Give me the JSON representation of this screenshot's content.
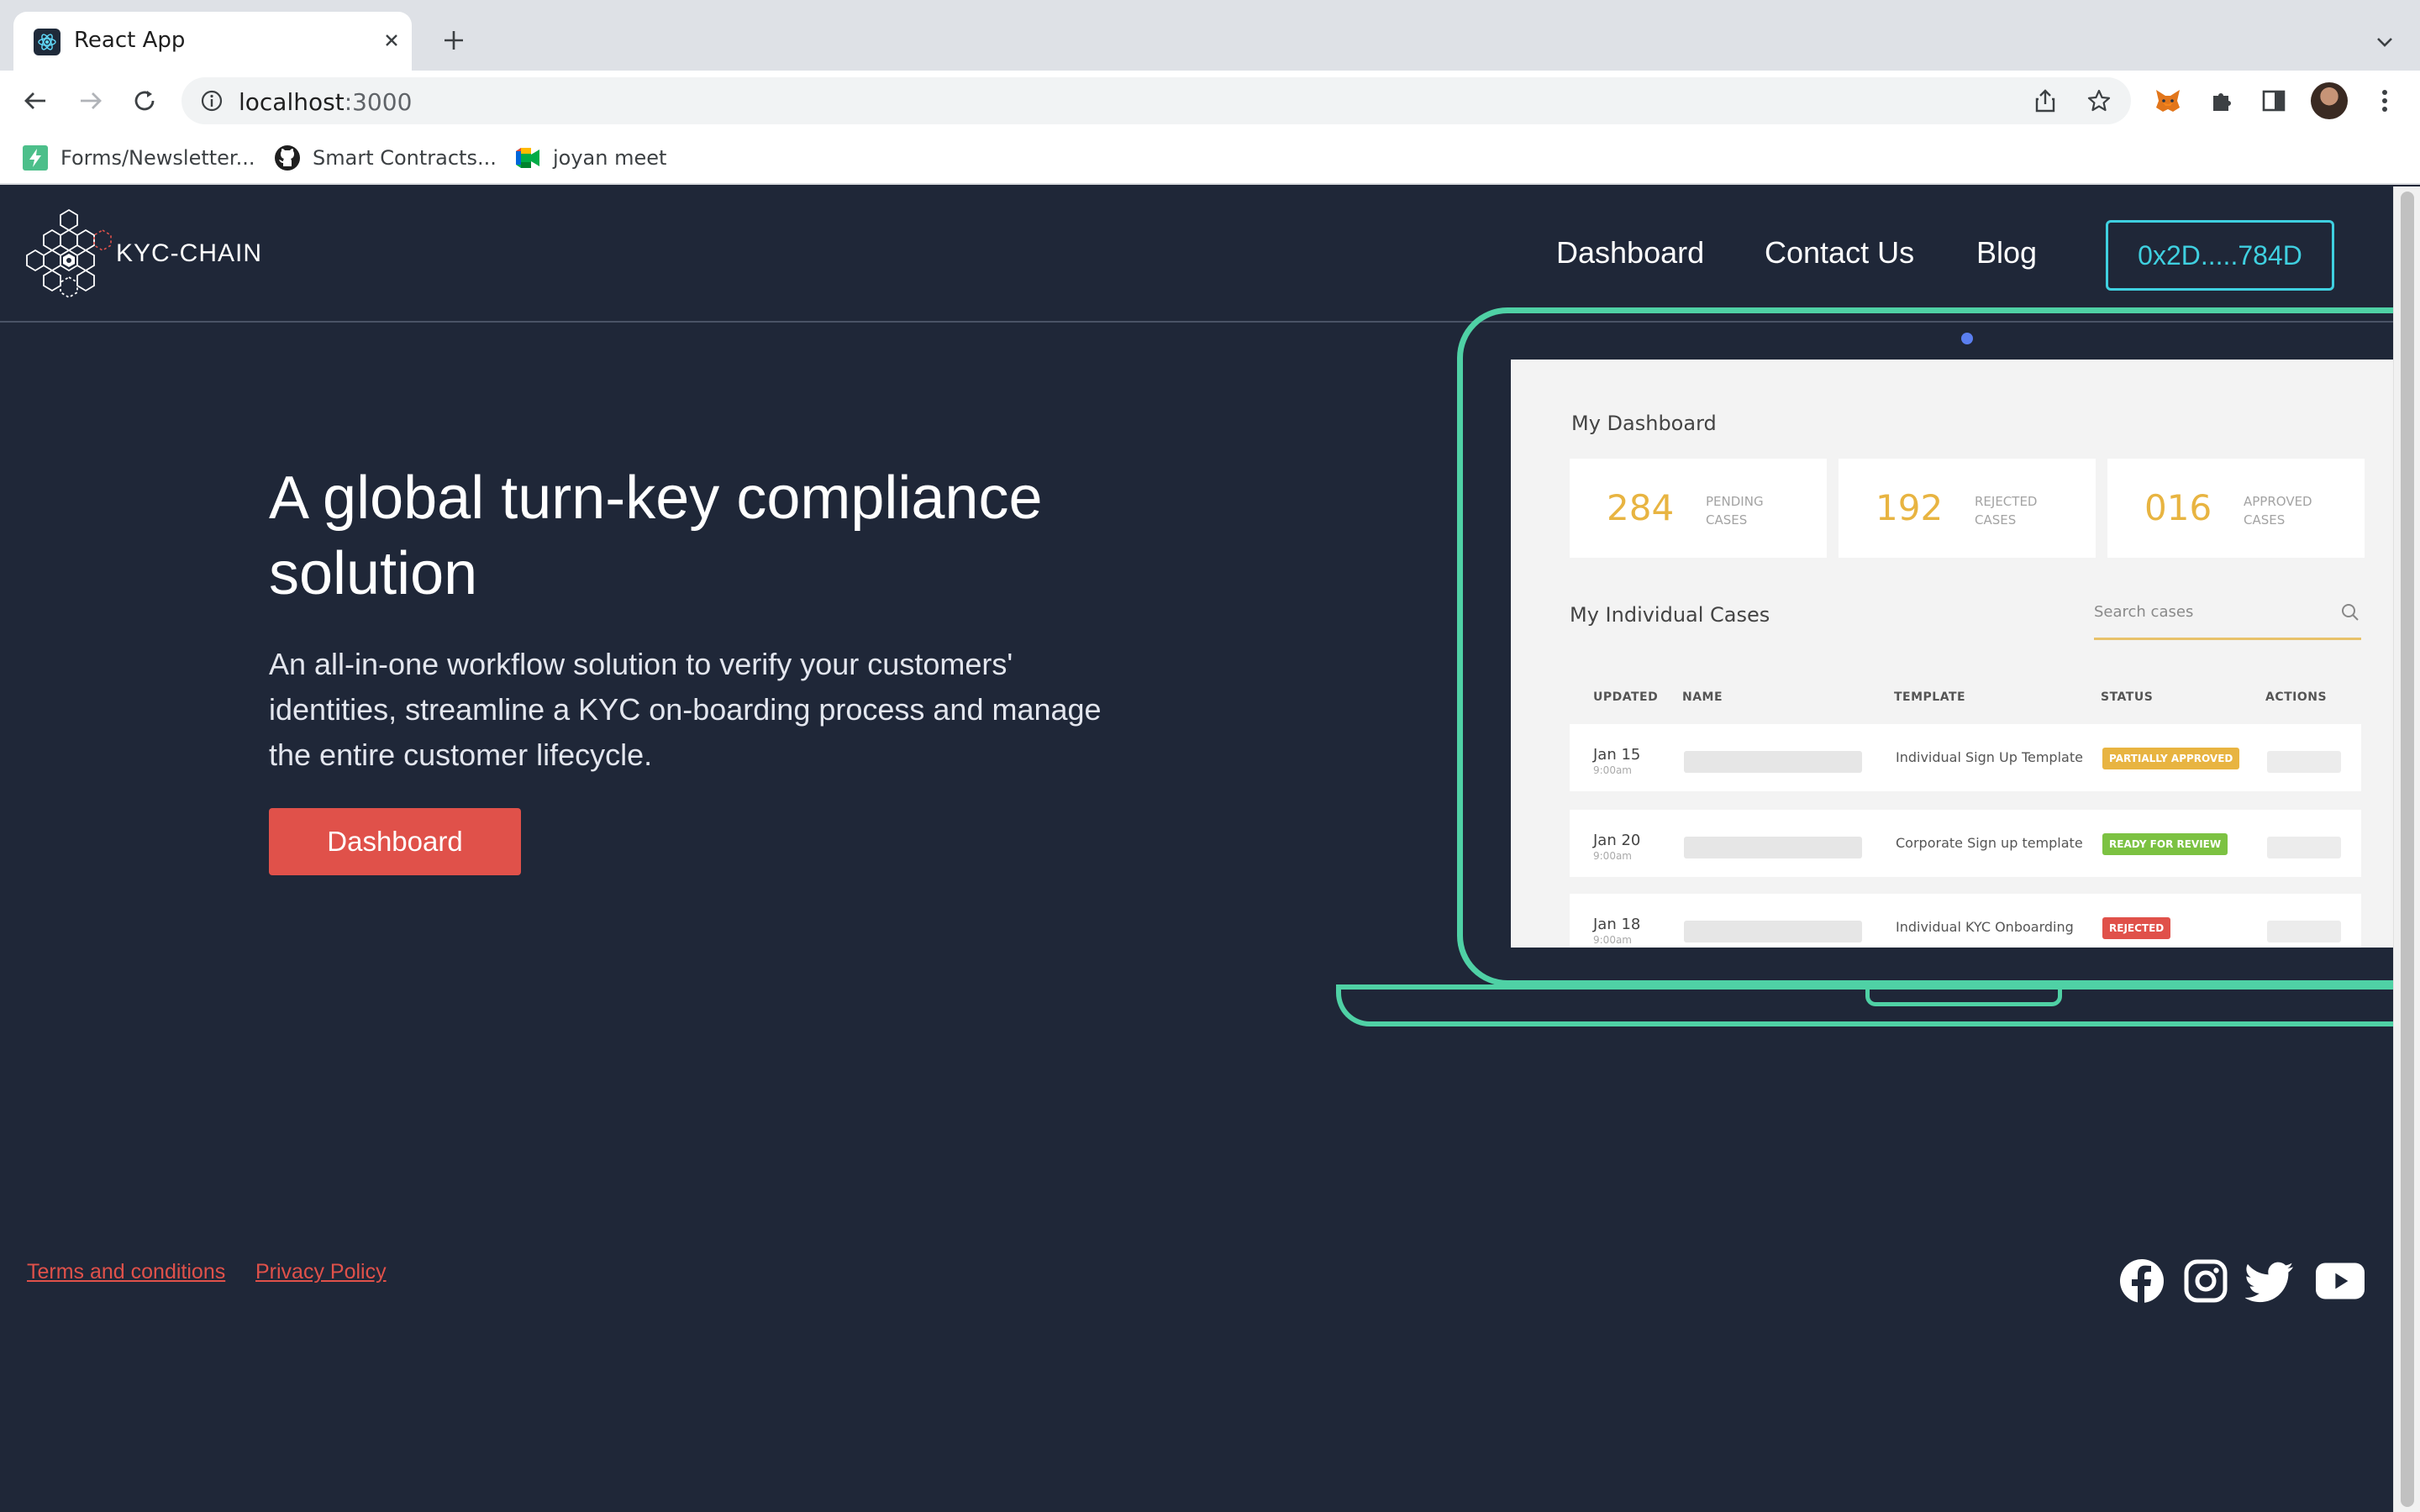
{
  "browser": {
    "tab_title": "React App",
    "url_host": "localhost",
    "url_port": ":3000",
    "bookmarks": [
      {
        "label": "Forms/Newsletter...",
        "icon": "bolt-icon"
      },
      {
        "label": "Smart Contracts...",
        "icon": "github-icon"
      },
      {
        "label": "joyan meet",
        "icon": "google-meet-icon"
      }
    ]
  },
  "nav": {
    "logo_text": "KYC-CHAIN",
    "links": [
      "Dashboard",
      "Contact Us",
      "Blog"
    ],
    "wallet": "0x2D.....784D"
  },
  "hero": {
    "title": "A global turn-key compliance solution",
    "description": "An all-in-one workflow solution to verify your customers' identities, streamline a KYC on-boarding process and manage the entire customer lifecycle.",
    "button": "Dashboard"
  },
  "mockup": {
    "dashboard_title": "My Dashboard",
    "stats": [
      {
        "value": "284",
        "label": "Pending cases"
      },
      {
        "value": "192",
        "label": "Rejected cases"
      },
      {
        "value": "016",
        "label": "Approved cases"
      }
    ],
    "cases_title": "My Individual Cases",
    "search_placeholder": "Search cases",
    "columns": [
      "UPDATED",
      "NAME",
      "TEMPLATE",
      "STATUS",
      "ACTIONS"
    ],
    "rows": [
      {
        "date": "Jan 15",
        "time": "9:00am",
        "template": "Individual Sign Up Template",
        "status": "PARTIALLY APPROVED",
        "status_color": "#e8b441"
      },
      {
        "date": "Jan 20",
        "time": "9:00am",
        "template": "Corporate Sign up template",
        "status": "READY FOR REVIEW",
        "status_color": "#7cc242"
      },
      {
        "date": "Jan 18",
        "time": "9:00am",
        "template": "Individual KYC Onboarding",
        "status": "REJECTED",
        "status_color": "#e0514a"
      }
    ]
  },
  "footer": {
    "links": [
      "Terms and conditions",
      "Privacy Policy"
    ],
    "social": [
      "facebook-icon",
      "instagram-icon",
      "twitter-icon",
      "youtube-icon"
    ]
  },
  "colors": {
    "background": "#1f2738",
    "accent_red": "#e0514a",
    "accent_cyan": "#3fd0e0",
    "laptop_green": "#4fd1a5"
  }
}
